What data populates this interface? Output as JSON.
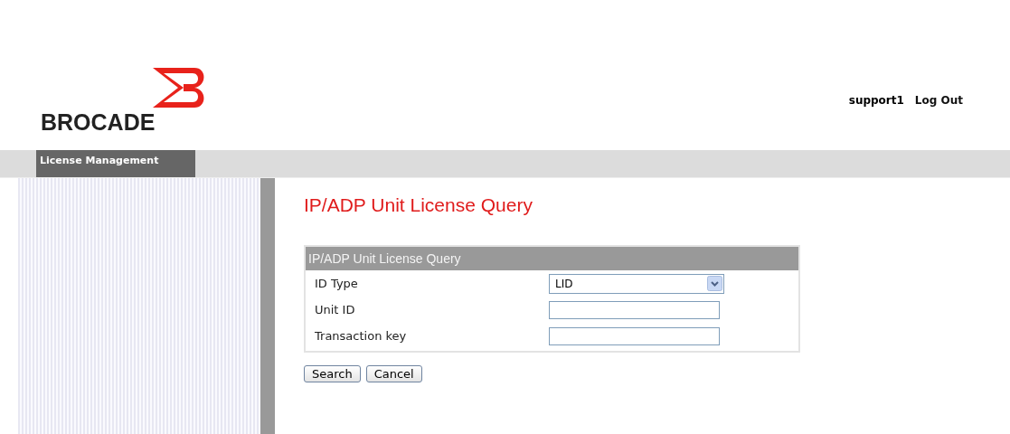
{
  "header": {
    "logo_text": "BROCADE",
    "user": "support1",
    "logout": "Log Out"
  },
  "nav": {
    "tabs": [
      {
        "label": "License Management",
        "selected": true
      }
    ]
  },
  "page_title": "IP/ADP Unit License Query",
  "form": {
    "title": "IP/ADP Unit License Query",
    "fields": [
      {
        "kind": "select",
        "label": "ID Type",
        "value": "LID"
      },
      {
        "kind": "text",
        "label": "Unit ID"
      },
      {
        "kind": "text",
        "label": "Transaction key"
      }
    ]
  },
  "buttons": [
    "Search",
    "Cancel"
  ]
}
